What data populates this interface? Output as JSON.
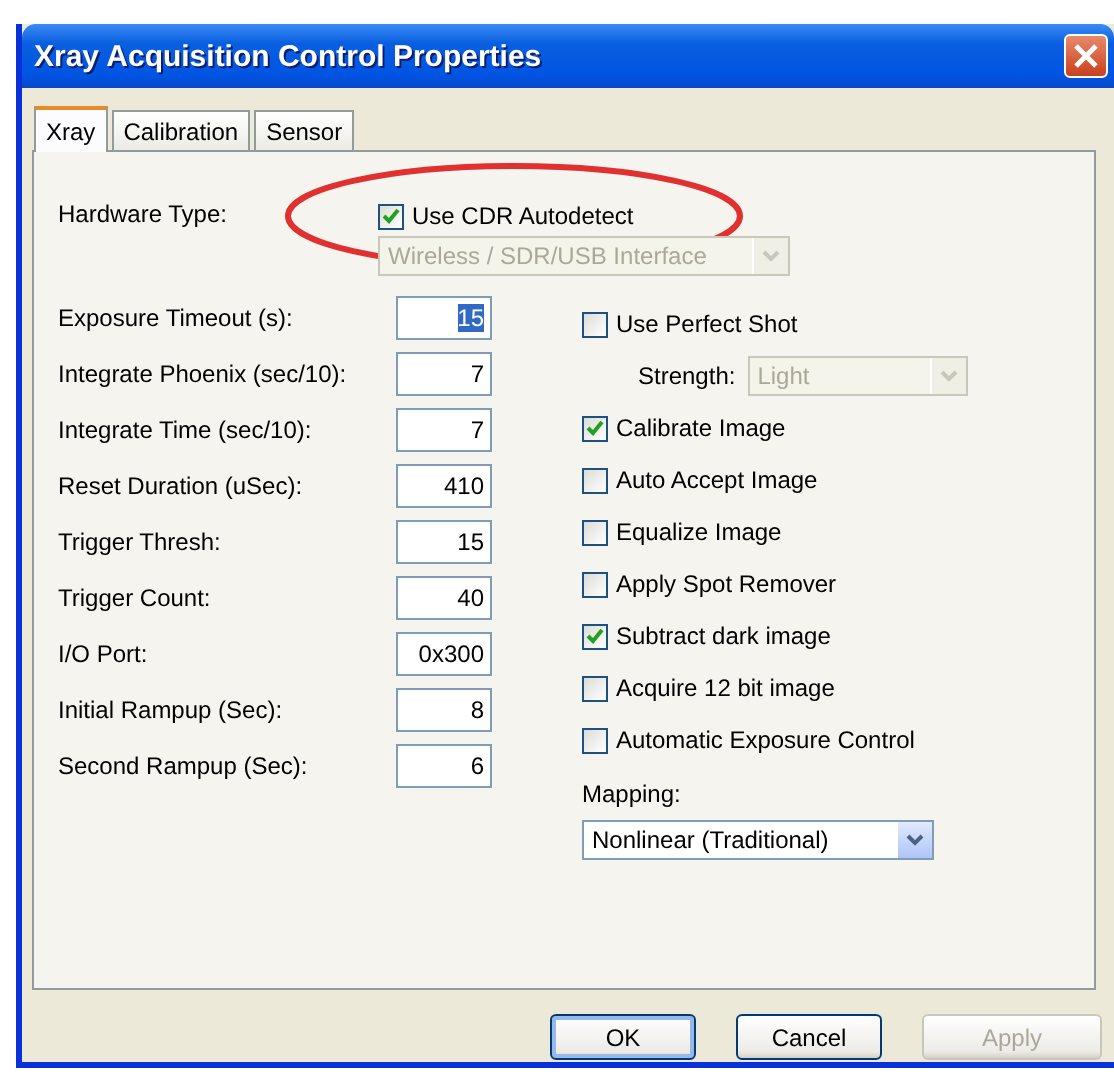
{
  "window": {
    "title": "Xray Acquisition Control Properties"
  },
  "tabs": [
    {
      "label": "Xray",
      "selected": true
    },
    {
      "label": "Calibration",
      "selected": false
    },
    {
      "label": "Sensor",
      "selected": false
    }
  ],
  "hardware": {
    "label": "Hardware Type:",
    "autodetect": {
      "label": "Use CDR Autodetect",
      "checked": true
    },
    "interface": {
      "value": "Wireless / SDR/USB Interface",
      "disabled": true
    }
  },
  "fields": [
    {
      "label": "Exposure Timeout (s):",
      "value": "15",
      "highlighted": true
    },
    {
      "label": "Integrate Phoenix (sec/10):",
      "value": "7",
      "highlighted": false
    },
    {
      "label": "Integrate Time (sec/10):",
      "value": "7",
      "highlighted": false
    },
    {
      "label": "Reset Duration (uSec):",
      "value": "410",
      "highlighted": false
    },
    {
      "label": "Trigger Thresh:",
      "value": "15",
      "highlighted": false
    },
    {
      "label": "Trigger Count:",
      "value": "40",
      "highlighted": false
    },
    {
      "label": "I/O Port:",
      "value": "0x300",
      "highlighted": false
    },
    {
      "label": "Initial Rampup (Sec):",
      "value": "8",
      "highlighted": false
    },
    {
      "label": "Second Rampup (Sec):",
      "value": "6",
      "highlighted": false
    }
  ],
  "options": [
    {
      "kind": "checkbox",
      "label": "Use Perfect Shot",
      "checked": false
    },
    {
      "kind": "dropdown",
      "label": "Strength:",
      "value": "Light",
      "disabled": true
    },
    {
      "kind": "checkbox",
      "label": "Calibrate Image",
      "checked": true
    },
    {
      "kind": "checkbox",
      "label": "Auto Accept Image",
      "checked": false
    },
    {
      "kind": "checkbox",
      "label": "Equalize Image",
      "checked": false
    },
    {
      "kind": "checkbox",
      "label": "Apply Spot Remover",
      "checked": false
    },
    {
      "kind": "checkbox",
      "label": "Subtract dark image",
      "checked": true
    },
    {
      "kind": "checkbox",
      "label": "Acquire 12 bit image",
      "checked": false
    },
    {
      "kind": "checkbox",
      "label": "Automatic Exposure Control",
      "checked": false
    }
  ],
  "mapping": {
    "label": "Mapping:",
    "value": "Nonlinear (Traditional)",
    "disabled": false
  },
  "buttons": [
    {
      "label": "OK",
      "default": true,
      "disabled": false
    },
    {
      "label": "Cancel",
      "default": false,
      "disabled": false
    },
    {
      "label": "Apply",
      "default": false,
      "disabled": true
    }
  ]
}
